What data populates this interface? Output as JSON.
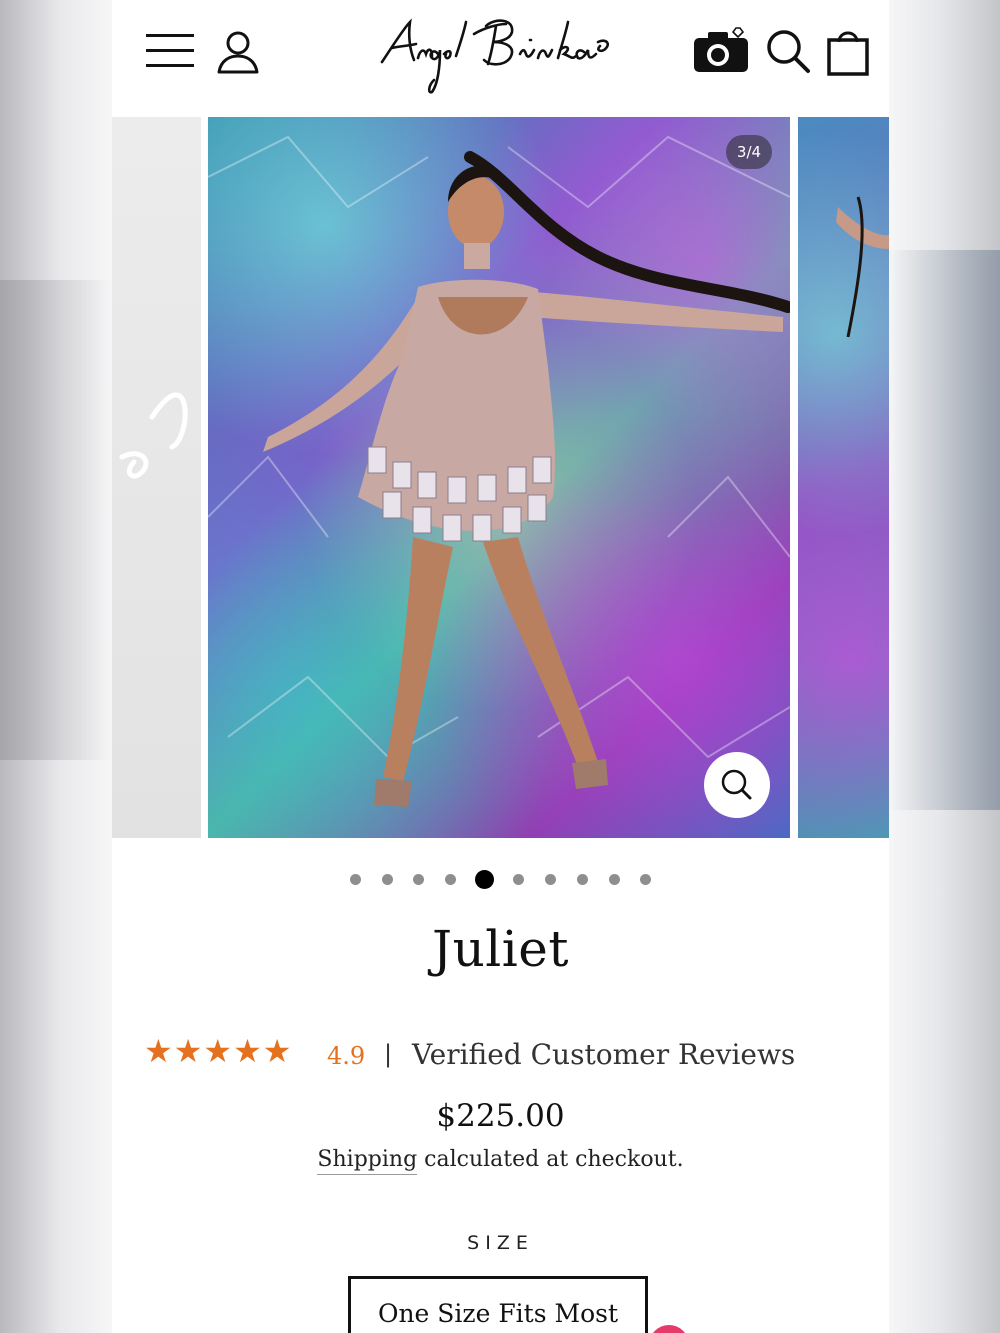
{
  "header": {
    "logo_text": "Angel Brinks",
    "icons": [
      "menu-icon",
      "user-icon",
      "camera-icon",
      "search-icon",
      "bag-icon"
    ]
  },
  "gallery": {
    "counter": "3/4",
    "dots_total": 10,
    "active_dot": 5
  },
  "product": {
    "title": "Juliet",
    "rating_stars": 5,
    "rating_value": "4.9",
    "separator": "|",
    "reviews_label": "Verified Customer Reviews",
    "price": "$225.00",
    "shipping_link": "Shipping",
    "shipping_text": " calculated at checkout.",
    "size_label": "SIZE",
    "size_option": "One Size Fits Most"
  },
  "colors": {
    "star": "#e5701e",
    "accent": "#111111"
  }
}
